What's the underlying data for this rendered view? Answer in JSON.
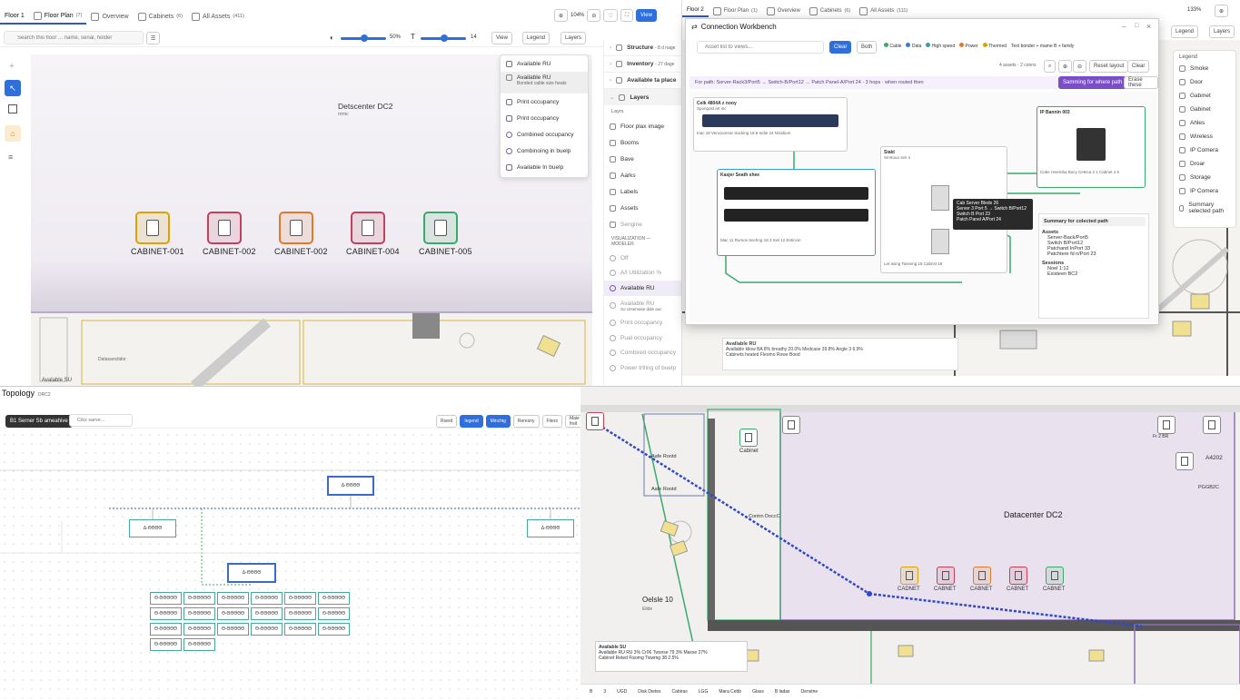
{
  "tl": {
    "tabs": [
      {
        "label": "Floor 1"
      },
      {
        "label": "Floor Plan",
        "count": "(7)"
      },
      {
        "label": "Overview"
      },
      {
        "label": "Cabinets",
        "count": "(6)"
      },
      {
        "label": "All Assets",
        "count": "(411)"
      }
    ],
    "zoom": "104%",
    "view_button": "View",
    "search_placeholder": "Search this floor ... name, serial, holder",
    "opacity_value": "50%",
    "text_value": "14",
    "view_label": "View",
    "legend_label": "Legend",
    "layers_label": "Layers",
    "menu": [
      {
        "label": "Available RU"
      },
      {
        "label": "Available RU",
        "sub": "Bonded cable size heats"
      },
      {
        "label": "Print occupancy"
      },
      {
        "label": "Print occupancy"
      },
      {
        "label": "Combined occupancy"
      },
      {
        "label": "Combinoing in buelp"
      },
      {
        "label": "Available In buelp"
      }
    ],
    "canvas_title": "Detscenter DC2",
    "canvas_sub": "rrrmc",
    "cabinets": [
      {
        "label": "CABINET-001",
        "color": "#d9a400"
      },
      {
        "label": "CABINET-002",
        "color": "#c2405a"
      },
      {
        "label": "CABINET-002",
        "color": "#e07a2a"
      },
      {
        "label": "CABINET-004",
        "color": "#c2405a"
      },
      {
        "label": "CABINET-005",
        "color": "#3aaa6a"
      }
    ],
    "room_label": "Datasanctidor",
    "avail_su": "Avalable SU"
  },
  "mid": {
    "items": [
      {
        "label": "Structure",
        "sub": "- 8 d nage"
      },
      {
        "label": "Inventory",
        "sub": "- 27 dage"
      },
      {
        "label": "Available ta place"
      }
    ],
    "layers_header": "Layers",
    "layers_sub": "Layrs",
    "layers": [
      "Floor plax image",
      "Booms",
      "Bave",
      "Aarks",
      "Labels",
      "Assets",
      "Sengine"
    ],
    "viz_header": "VISUALIZATION — MODELER",
    "viz": [
      "Off",
      "A/l Utilization %",
      "Available RU",
      "Available RU",
      "Print occupancy",
      "Pual occupancy",
      "Combired occupancy",
      "Power trtling of buelp"
    ],
    "viz_sub": "So cirsemase dide auc"
  },
  "tr": {
    "tabs": [
      {
        "label": "Floor 2"
      },
      {
        "label": "Floor Plan",
        "count": "(1)"
      },
      {
        "label": "Overview"
      },
      {
        "label": "Cabinets",
        "count": "(6)"
      },
      {
        "label": "All Assets",
        "count": "(111)"
      }
    ],
    "zoom": "133%",
    "legend_button": "Legend",
    "layers_button": "Layers",
    "legend_title": "Legend",
    "legend": [
      "Smoke",
      "Door",
      "Gabinet",
      "Gabinet",
      "Ahles",
      "Wireless",
      "IP Comera",
      "Droar",
      "Storage",
      "IP Comera",
      "Summary selected path"
    ],
    "avail_title": "Avallable RU",
    "avail_line": "Avallable kilow BA 8%  breathy 20.0%  Medcase 39.8%  Angle 3 6.9%",
    "avail_line2": "Cabinets heated  Fleomo  Rowe  Boed"
  },
  "wb": {
    "title": "Connection Workbench",
    "search_placeholder": "Asset list to views...",
    "chips": [
      "Clear",
      "Both"
    ],
    "filters": [
      "Cable",
      "Data",
      "High speed",
      "Power",
      "Thermed",
      "Text bonder + mame B + family"
    ],
    "assets_count": "4 assets · 2 conns",
    "reset_label": "Reset layout",
    "clear_label": "Clear",
    "path_text": "For path:  Server-Rack3/Port5 → Switch-B/Port12 → Patch Panel-A/Port 24 · 3 hops · when routed then",
    "save_button": "Samming for where path",
    "erase_button": "Erase these",
    "card1_title": "Celk 4804A z nooy",
    "card1_sub": "Spongold art inc",
    "card1_meta": "Inac 18 Vencioonrar   Sacking 18.9   Indie 24   N/sidium",
    "card2_title": "Kasjer Seath shee",
    "card2_meta": "Mac 11 Rumos   Sechng 18.3   Inel 12   Enticion",
    "card3_title": "Siakt",
    "card3_sub": "Smrtouo sim 4",
    "card3_meta": "Let asing   Tasseng 18   Cabnst 18",
    "card4_title": "IP Bannin 003",
    "card4_meta": "Cobe resemba Bucy  Ceteca 2 1  Cabnet 4 6",
    "tooltip_l1": "Cab Server Bleds 26",
    "tooltip_l2": "Server 3 Port 5 → Switch B/Port12",
    "tooltip_l3": "Switch B Port 23",
    "tooltip_l4": "Patch Panel A/Port 24",
    "summary_title": "Summary for colected path",
    "summary_assets": "Assets",
    "summary_items": [
      "Server-Back/Port5",
      "Switch B/Port12",
      "Patchand InPort 33",
      "Patchtere fd n/Port 23"
    ],
    "summary_sessions": "Sessions",
    "summary_sess_items": [
      "Noel 1:12",
      "Existeen BC2"
    ]
  },
  "bl": {
    "title": "Topology",
    "title_sub": "DRC2",
    "chip": "B1 Serner  Sb ameahive",
    "search_placeholder": "Ciks sarve...",
    "btns": [
      "Rserd",
      "Iegend",
      "Minchig",
      "Reresny",
      "Fiters",
      "Maie freit"
    ],
    "root": "Δ-ΘΘΘΘ",
    "n1": "Δ-ΘΘΘΘ",
    "n2": "Δ-ΘΘΘΘ",
    "n3": "Δ-ΘΘΘΘ",
    "leaf": "Θ-ΘΘΘΘΘ"
  },
  "br": {
    "title": "Datacenter DC2",
    "cabinet_label": "Cabinet",
    "cabinets": [
      {
        "label": "CADNET",
        "color": "#d9a400"
      },
      {
        "label": "CABNET",
        "color": "#c2405a"
      },
      {
        "label": "CABNET",
        "color": "#e07a2a"
      },
      {
        "label": "CABNET",
        "color": "#c2405a"
      },
      {
        "label": "CABNET",
        "color": "#3aaa6a"
      }
    ],
    "room1": "Oelsle 10",
    "room1_sub": "Elide",
    "room2": "Aafe Rootd",
    "room2b": "Aafe Rootd",
    "conn_label": "Contrn DoccC",
    "right_lbl": "A4202",
    "right_lbl2": "PGGB2C",
    "right_lbl3": "Fr 2 BR",
    "avail_title": "Available SU",
    "avail_l1": "Avallable RU  RU 3%  Cr06   Twsnse 79 3%   Maxxe 27%",
    "avail_l2": "Cabinet Reted   Fisomg   Tiswmg  38 2.5%",
    "bottom": [
      "B",
      "3",
      "UGD",
      "Disk Dietes",
      "Cabiras",
      "LGG",
      "Mara Cebb",
      "Glass",
      "B ladas",
      "Denstne"
    ]
  }
}
